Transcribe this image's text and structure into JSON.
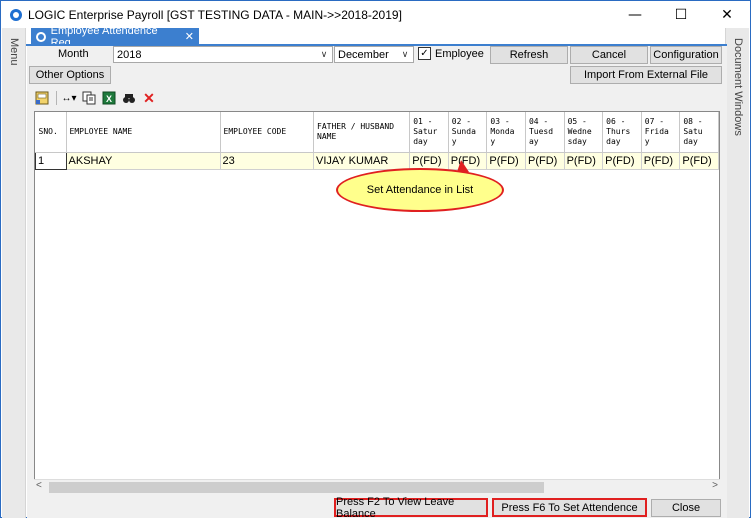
{
  "window": {
    "title": "LOGIC Enterprise Payroll  [GST TESTING DATA - MAIN->>2018-2019]",
    "minimize": "—",
    "maximize": "☐",
    "close": "✕"
  },
  "side_panels": {
    "left": "Menu",
    "right": "Document Windows"
  },
  "tab": {
    "label": "Employee Attendence Reg...",
    "close": "✕"
  },
  "filters": {
    "month_label": "Month",
    "year_value": "2018",
    "month_value": "December",
    "employee_checkbox_label": "Employee",
    "employee_checked": true
  },
  "buttons": {
    "refresh": "Refresh",
    "cancel": "Cancel",
    "configuration": "Configuration",
    "other_options": "Other Options",
    "import": "Import From External File",
    "view_leave": "Press F2 To View Leave Balance",
    "set_attendance": "Press F6 To Set Attendence",
    "close": "Close"
  },
  "toolbar": {
    "icons": [
      "save-layout-icon",
      "column-width-icon",
      "copy-icon",
      "excel-icon",
      "find-icon",
      "delete-icon"
    ]
  },
  "grid": {
    "columns": [
      "SNO.",
      "EMPLOYEE NAME",
      "EMPLOYEE CODE",
      "FATHER / HUSBAND\nNAME",
      "01 -\nSatur\nday",
      "02 -\nSunda\ny",
      "03 -\nMonda\ny",
      "04 -\nTuesd\nay",
      "05 -\nWedne\nsday",
      "06 -\nThurs\nday",
      "07 -\nFrida\ny",
      "08 -\nSatu\nday"
    ],
    "rows": [
      [
        "1",
        "AKSHAY",
        "23",
        "VIJAY KUMAR",
        "P(FD)",
        "P(FD)",
        "P(FD)",
        "P(FD)",
        "P(FD)",
        "P(FD)",
        "P(FD)",
        "P(FD)"
      ]
    ]
  },
  "callout": {
    "text": "Set Attendance in List"
  },
  "scrollbar": {
    "left_arrow": "<",
    "right_arrow": ">"
  }
}
